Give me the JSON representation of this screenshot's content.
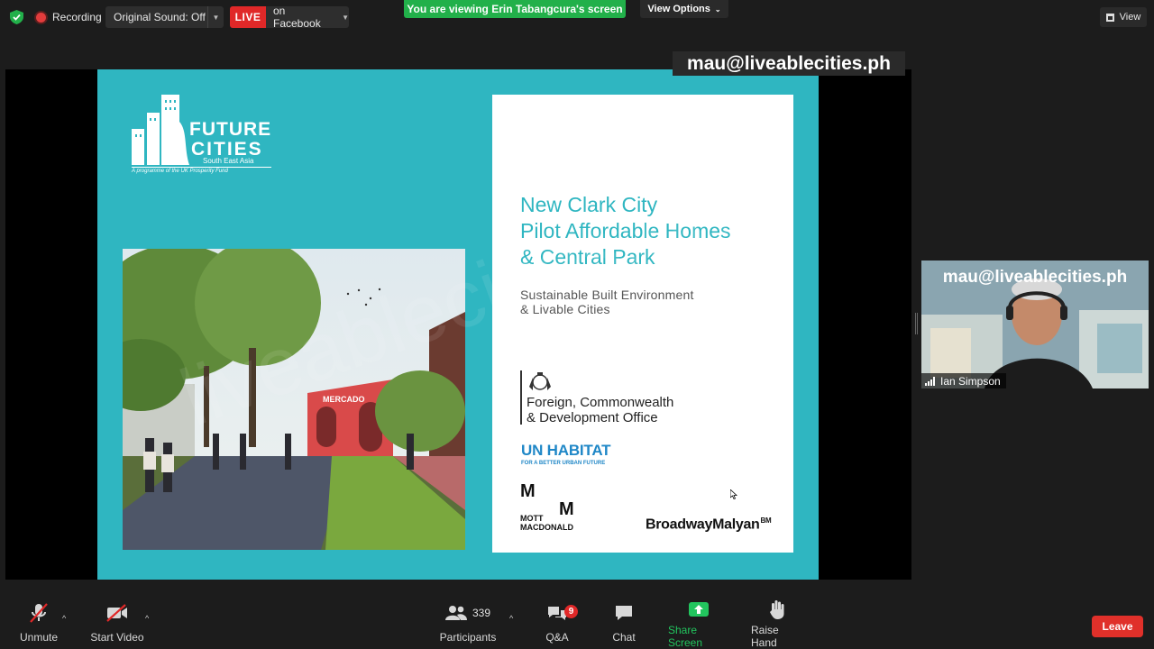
{
  "topbar": {
    "recording_label": "Recording",
    "original_sound": "Original Sound: Off",
    "live_badge": "LIVE",
    "live_target": "on Facebook",
    "viewing_banner": "You are viewing Erin Tabangcura's screen",
    "view_options": "View Options",
    "view_label": "View"
  },
  "watermark": "mau@liveablecities.ph",
  "slide": {
    "logo_word1": "FUTURE",
    "logo_word2": "CITIES",
    "logo_region": "South East Asia",
    "logo_programme": "A programme of the UK Prosperity Fund",
    "title": "New Clark City\nPilot Affordable Homes\n& Central Park",
    "subtitle": "Sustainable Built Environment\n& Livable Cities",
    "fcdo": "Foreign, Commonwealth\n& Development Office",
    "un_habitat": "UN HABITAT",
    "un_tagline": "FOR A BETTER URBAN FUTURE",
    "mott_m": "M",
    "mott_macdonald": "MOTT\nMACDONALD",
    "broadway_malyan": "BroadwayMalyan",
    "broadway_mark": "BM",
    "photo_sign": "MERCADO",
    "faint_watermark": "liveablecities.ph"
  },
  "video": {
    "watermark": "mau@liveablecities.ph",
    "participant_name": "Ian Simpson"
  },
  "toolbar": {
    "unmute": "Unmute",
    "start_video": "Start Video",
    "participants": "Participants",
    "participants_count": "339",
    "qa": "Q&A",
    "qa_badge": "9",
    "chat": "Chat",
    "share_screen": "Share Screen",
    "raise_hand": "Raise Hand",
    "leave": "Leave"
  },
  "colors": {
    "slide_teal": "#2fb6c1",
    "live_red": "#e02828",
    "banner_green": "#22b04a",
    "share_green": "#22c55e",
    "leave_red": "#e0302a",
    "un_blue": "#1f87c7"
  }
}
